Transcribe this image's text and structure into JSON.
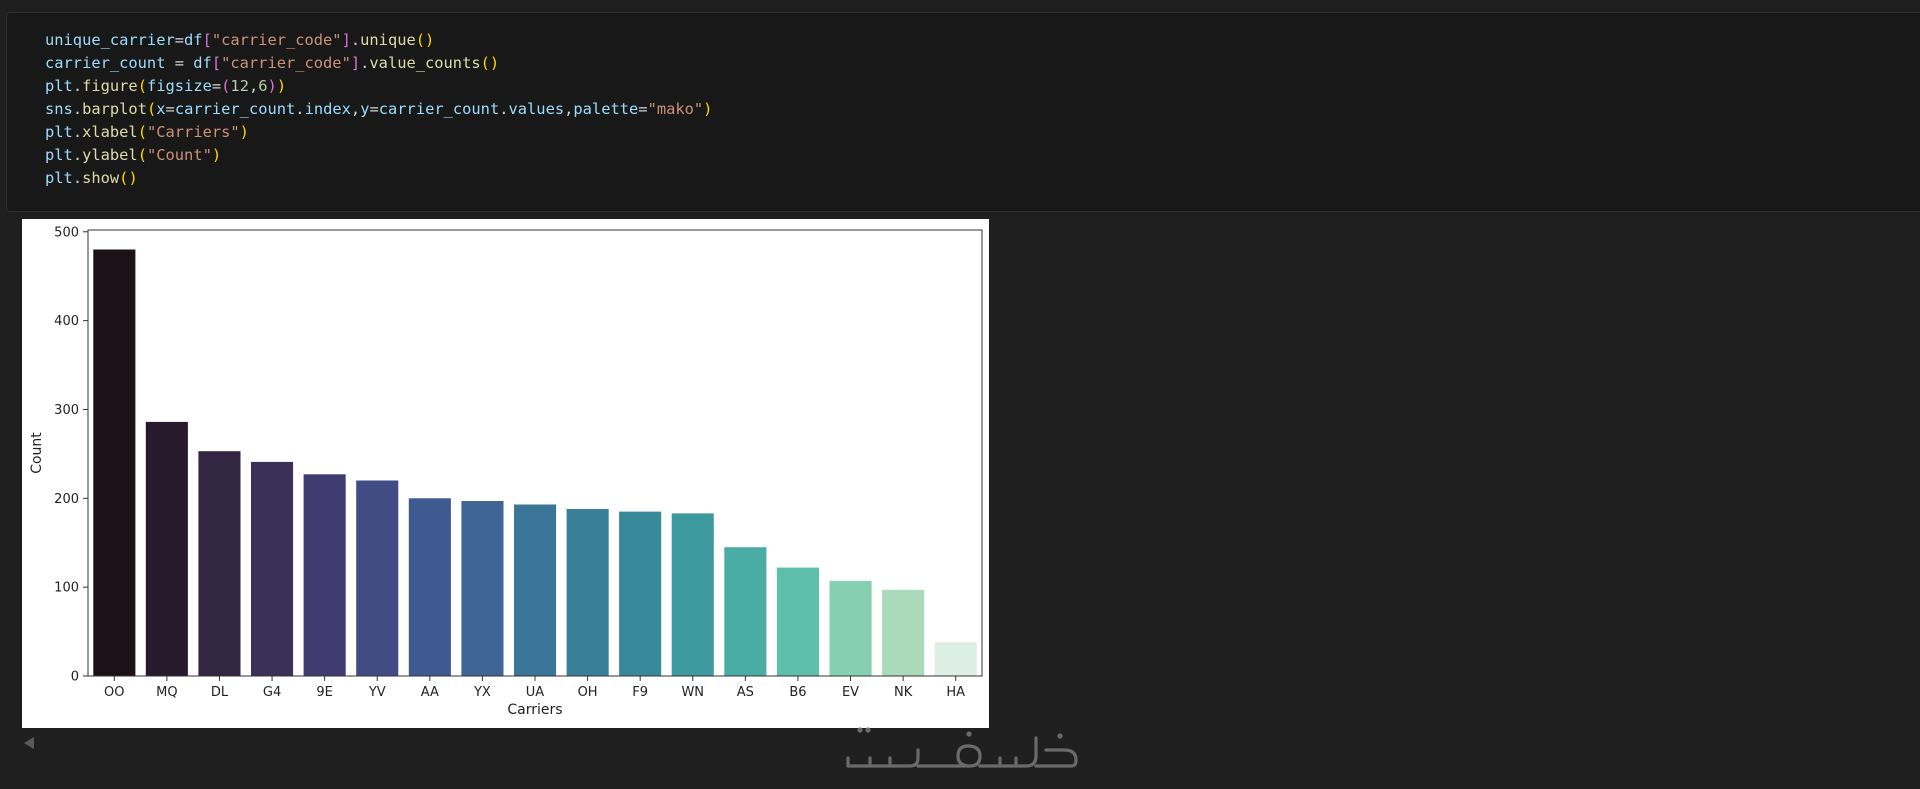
{
  "code_cell": {
    "lines": [
      [
        {
          "t": "unique_carrier",
          "c": "var"
        },
        {
          "t": "=",
          "c": "op"
        },
        {
          "t": "df",
          "c": "var"
        },
        {
          "t": "[",
          "c": "punc2"
        },
        {
          "t": "\"carrier_code\"",
          "c": "str"
        },
        {
          "t": "]",
          "c": "punc2"
        },
        {
          "t": ".",
          "c": "op"
        },
        {
          "t": "unique",
          "c": "fn"
        },
        {
          "t": "()",
          "c": "punc"
        }
      ],
      [
        {
          "t": "carrier_count",
          "c": "var"
        },
        {
          "t": " = ",
          "c": "op"
        },
        {
          "t": "df",
          "c": "var"
        },
        {
          "t": "[",
          "c": "punc2"
        },
        {
          "t": "\"carrier_code\"",
          "c": "str"
        },
        {
          "t": "]",
          "c": "punc2"
        },
        {
          "t": ".",
          "c": "op"
        },
        {
          "t": "value_counts",
          "c": "fn"
        },
        {
          "t": "()",
          "c": "punc"
        }
      ],
      [
        {
          "t": "plt",
          "c": "var"
        },
        {
          "t": ".",
          "c": "op"
        },
        {
          "t": "figure",
          "c": "fn"
        },
        {
          "t": "(",
          "c": "punc"
        },
        {
          "t": "figsize",
          "c": "var"
        },
        {
          "t": "=",
          "c": "op"
        },
        {
          "t": "(",
          "c": "punc2"
        },
        {
          "t": "12",
          "c": "num"
        },
        {
          "t": ",",
          "c": "op"
        },
        {
          "t": "6",
          "c": "num"
        },
        {
          "t": ")",
          "c": "punc2"
        },
        {
          "t": ")",
          "c": "punc"
        }
      ],
      [
        {
          "t": "sns",
          "c": "var"
        },
        {
          "t": ".",
          "c": "op"
        },
        {
          "t": "barplot",
          "c": "fn"
        },
        {
          "t": "(",
          "c": "punc"
        },
        {
          "t": "x",
          "c": "var"
        },
        {
          "t": "=",
          "c": "op"
        },
        {
          "t": "carrier_count",
          "c": "var"
        },
        {
          "t": ".",
          "c": "op"
        },
        {
          "t": "index",
          "c": "var"
        },
        {
          "t": ",",
          "c": "op"
        },
        {
          "t": "y",
          "c": "var"
        },
        {
          "t": "=",
          "c": "op"
        },
        {
          "t": "carrier_count",
          "c": "var"
        },
        {
          "t": ".",
          "c": "op"
        },
        {
          "t": "values",
          "c": "var"
        },
        {
          "t": ",",
          "c": "op"
        },
        {
          "t": "palette",
          "c": "var"
        },
        {
          "t": "=",
          "c": "op"
        },
        {
          "t": "\"mako\"",
          "c": "str"
        },
        {
          "t": ")",
          "c": "punc"
        }
      ],
      [
        {
          "t": "plt",
          "c": "var"
        },
        {
          "t": ".",
          "c": "op"
        },
        {
          "t": "xlabel",
          "c": "fn"
        },
        {
          "t": "(",
          "c": "punc"
        },
        {
          "t": "\"Carriers\"",
          "c": "str"
        },
        {
          "t": ")",
          "c": "punc"
        }
      ],
      [
        {
          "t": "plt",
          "c": "var"
        },
        {
          "t": ".",
          "c": "op"
        },
        {
          "t": "ylabel",
          "c": "fn"
        },
        {
          "t": "(",
          "c": "punc"
        },
        {
          "t": "\"Count\"",
          "c": "str"
        },
        {
          "t": ")",
          "c": "punc"
        }
      ],
      [
        {
          "t": "plt",
          "c": "var"
        },
        {
          "t": ".",
          "c": "op"
        },
        {
          "t": "show",
          "c": "fn"
        },
        {
          "t": "()",
          "c": "punc"
        }
      ]
    ]
  },
  "chart_data": {
    "type": "bar",
    "title": "",
    "xlabel": "Carriers",
    "ylabel": "Count",
    "categories": [
      "OO",
      "MQ",
      "DL",
      "G4",
      "9E",
      "YV",
      "AA",
      "YX",
      "UA",
      "OH",
      "F9",
      "WN",
      "AS",
      "B6",
      "EV",
      "NK",
      "HA"
    ],
    "values": [
      480,
      286,
      253,
      241,
      227,
      220,
      200,
      197,
      193,
      188,
      185,
      183,
      145,
      122,
      107,
      97,
      38
    ],
    "colors": [
      "#1c1117",
      "#271a2c",
      "#332643",
      "#3a3058",
      "#403b70",
      "#414c85",
      "#3f5a90",
      "#3e6596",
      "#3b7597",
      "#3a7f98",
      "#38899a",
      "#3d9a9e",
      "#4aaca4",
      "#5dbeaa",
      "#86d0b1",
      "#aadab9",
      "#ddefe4"
    ],
    "yticks": [
      0,
      100,
      200,
      300,
      400,
      500
    ],
    "ylim": [
      0,
      502
    ],
    "grid": false,
    "legend": "none"
  },
  "icons": {
    "collapse": "triangle-left-icon",
    "watermark": "khamsat-logo"
  },
  "watermark_text": "خمسات"
}
